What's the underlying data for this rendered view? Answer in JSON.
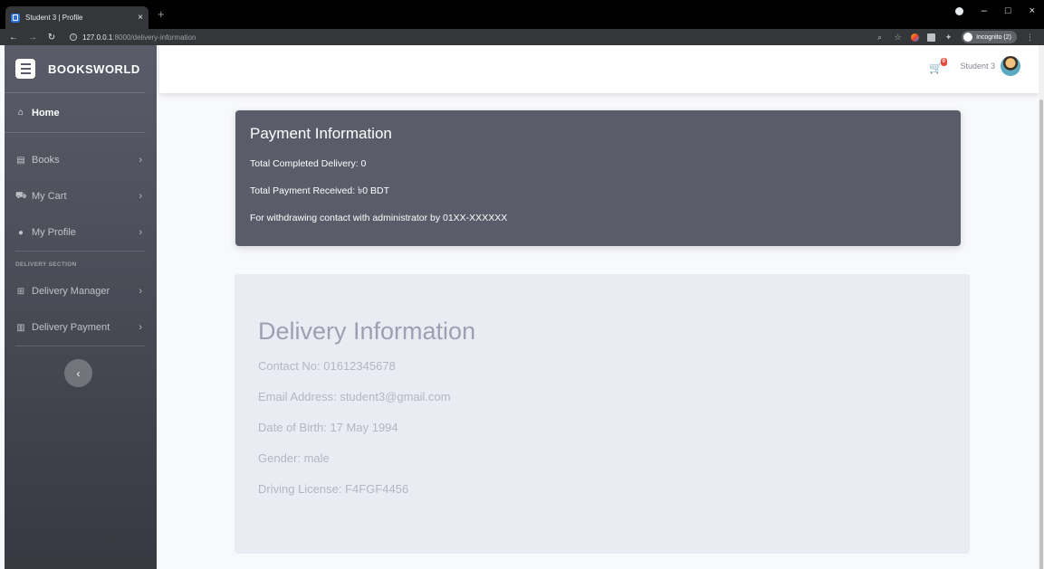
{
  "browser": {
    "tab_title": "Student 3 | Profile",
    "tab_close": "×",
    "new_tab": "+",
    "url_host": "127.0.0.1",
    "url_path": ":8000/delivery-information",
    "incognito_label": "Incognito (2)",
    "window_controls": [
      "–",
      "□",
      "×"
    ]
  },
  "sidebar": {
    "brand": "BOOKSWORLD",
    "home_label": "Home",
    "items": [
      {
        "label": "Books",
        "icon": "book-icon"
      },
      {
        "label": "My Cart",
        "icon": "cart-icon"
      },
      {
        "label": "My Profile",
        "icon": "user-icon"
      }
    ],
    "section_heading": "DELIVERY SECTION",
    "delivery_items": [
      {
        "label": "Delivery Manager",
        "icon": "table-icon"
      },
      {
        "label": "Delivery Payment",
        "icon": "chart-icon"
      }
    ],
    "toggle_glyph": "‹"
  },
  "topbar": {
    "cart_count": "0",
    "user_name": "Student 3"
  },
  "payment": {
    "title": "Payment Information",
    "total_completed": "Total Completed Delivery: 0",
    "total_received": "Total Payment Received: ৳0 BDT",
    "withdraw_note": "For withdrawing contact with administrator by 01XX-XXXXXX"
  },
  "delivery": {
    "title": "Delivery Information",
    "contact": "Contact No: 01612345678",
    "email": "Email Address: student3@gmail.com",
    "dob": "Date of Birth: 17 May 1994",
    "gender": "Gender: male",
    "license": "Driving License: F4FGF4456"
  },
  "colors": {
    "sidebar_top": "#5a5c69",
    "sidebar_bottom": "#373840",
    "payment_card": "#5a5c69",
    "delivery_card": "#eaecf4",
    "badge": "#e74a3b"
  }
}
